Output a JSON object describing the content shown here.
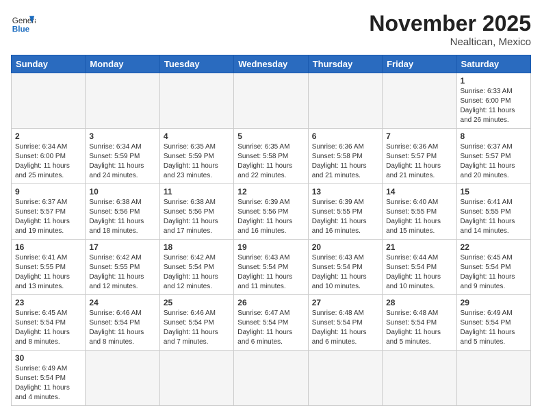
{
  "header": {
    "logo_general": "General",
    "logo_blue": "Blue",
    "month_title": "November 2025",
    "location": "Nealtican, Mexico"
  },
  "weekdays": [
    "Sunday",
    "Monday",
    "Tuesday",
    "Wednesday",
    "Thursday",
    "Friday",
    "Saturday"
  ],
  "weeks": [
    [
      {
        "day": "",
        "info": ""
      },
      {
        "day": "",
        "info": ""
      },
      {
        "day": "",
        "info": ""
      },
      {
        "day": "",
        "info": ""
      },
      {
        "day": "",
        "info": ""
      },
      {
        "day": "",
        "info": ""
      },
      {
        "day": "1",
        "info": "Sunrise: 6:33 AM\nSunset: 6:00 PM\nDaylight: 11 hours\nand 26 minutes."
      }
    ],
    [
      {
        "day": "2",
        "info": "Sunrise: 6:34 AM\nSunset: 6:00 PM\nDaylight: 11 hours\nand 25 minutes."
      },
      {
        "day": "3",
        "info": "Sunrise: 6:34 AM\nSunset: 5:59 PM\nDaylight: 11 hours\nand 24 minutes."
      },
      {
        "day": "4",
        "info": "Sunrise: 6:35 AM\nSunset: 5:59 PM\nDaylight: 11 hours\nand 23 minutes."
      },
      {
        "day": "5",
        "info": "Sunrise: 6:35 AM\nSunset: 5:58 PM\nDaylight: 11 hours\nand 22 minutes."
      },
      {
        "day": "6",
        "info": "Sunrise: 6:36 AM\nSunset: 5:58 PM\nDaylight: 11 hours\nand 21 minutes."
      },
      {
        "day": "7",
        "info": "Sunrise: 6:36 AM\nSunset: 5:57 PM\nDaylight: 11 hours\nand 21 minutes."
      },
      {
        "day": "8",
        "info": "Sunrise: 6:37 AM\nSunset: 5:57 PM\nDaylight: 11 hours\nand 20 minutes."
      }
    ],
    [
      {
        "day": "9",
        "info": "Sunrise: 6:37 AM\nSunset: 5:57 PM\nDaylight: 11 hours\nand 19 minutes."
      },
      {
        "day": "10",
        "info": "Sunrise: 6:38 AM\nSunset: 5:56 PM\nDaylight: 11 hours\nand 18 minutes."
      },
      {
        "day": "11",
        "info": "Sunrise: 6:38 AM\nSunset: 5:56 PM\nDaylight: 11 hours\nand 17 minutes."
      },
      {
        "day": "12",
        "info": "Sunrise: 6:39 AM\nSunset: 5:56 PM\nDaylight: 11 hours\nand 16 minutes."
      },
      {
        "day": "13",
        "info": "Sunrise: 6:39 AM\nSunset: 5:55 PM\nDaylight: 11 hours\nand 16 minutes."
      },
      {
        "day": "14",
        "info": "Sunrise: 6:40 AM\nSunset: 5:55 PM\nDaylight: 11 hours\nand 15 minutes."
      },
      {
        "day": "15",
        "info": "Sunrise: 6:41 AM\nSunset: 5:55 PM\nDaylight: 11 hours\nand 14 minutes."
      }
    ],
    [
      {
        "day": "16",
        "info": "Sunrise: 6:41 AM\nSunset: 5:55 PM\nDaylight: 11 hours\nand 13 minutes."
      },
      {
        "day": "17",
        "info": "Sunrise: 6:42 AM\nSunset: 5:55 PM\nDaylight: 11 hours\nand 12 minutes."
      },
      {
        "day": "18",
        "info": "Sunrise: 6:42 AM\nSunset: 5:54 PM\nDaylight: 11 hours\nand 12 minutes."
      },
      {
        "day": "19",
        "info": "Sunrise: 6:43 AM\nSunset: 5:54 PM\nDaylight: 11 hours\nand 11 minutes."
      },
      {
        "day": "20",
        "info": "Sunrise: 6:43 AM\nSunset: 5:54 PM\nDaylight: 11 hours\nand 10 minutes."
      },
      {
        "day": "21",
        "info": "Sunrise: 6:44 AM\nSunset: 5:54 PM\nDaylight: 11 hours\nand 10 minutes."
      },
      {
        "day": "22",
        "info": "Sunrise: 6:45 AM\nSunset: 5:54 PM\nDaylight: 11 hours\nand 9 minutes."
      }
    ],
    [
      {
        "day": "23",
        "info": "Sunrise: 6:45 AM\nSunset: 5:54 PM\nDaylight: 11 hours\nand 8 minutes."
      },
      {
        "day": "24",
        "info": "Sunrise: 6:46 AM\nSunset: 5:54 PM\nDaylight: 11 hours\nand 8 minutes."
      },
      {
        "day": "25",
        "info": "Sunrise: 6:46 AM\nSunset: 5:54 PM\nDaylight: 11 hours\nand 7 minutes."
      },
      {
        "day": "26",
        "info": "Sunrise: 6:47 AM\nSunset: 5:54 PM\nDaylight: 11 hours\nand 6 minutes."
      },
      {
        "day": "27",
        "info": "Sunrise: 6:48 AM\nSunset: 5:54 PM\nDaylight: 11 hours\nand 6 minutes."
      },
      {
        "day": "28",
        "info": "Sunrise: 6:48 AM\nSunset: 5:54 PM\nDaylight: 11 hours\nand 5 minutes."
      },
      {
        "day": "29",
        "info": "Sunrise: 6:49 AM\nSunset: 5:54 PM\nDaylight: 11 hours\nand 5 minutes."
      }
    ],
    [
      {
        "day": "30",
        "info": "Sunrise: 6:49 AM\nSunset: 5:54 PM\nDaylight: 11 hours\nand 4 minutes."
      },
      {
        "day": "",
        "info": ""
      },
      {
        "day": "",
        "info": ""
      },
      {
        "day": "",
        "info": ""
      },
      {
        "day": "",
        "info": ""
      },
      {
        "day": "",
        "info": ""
      },
      {
        "day": "",
        "info": ""
      }
    ]
  ]
}
